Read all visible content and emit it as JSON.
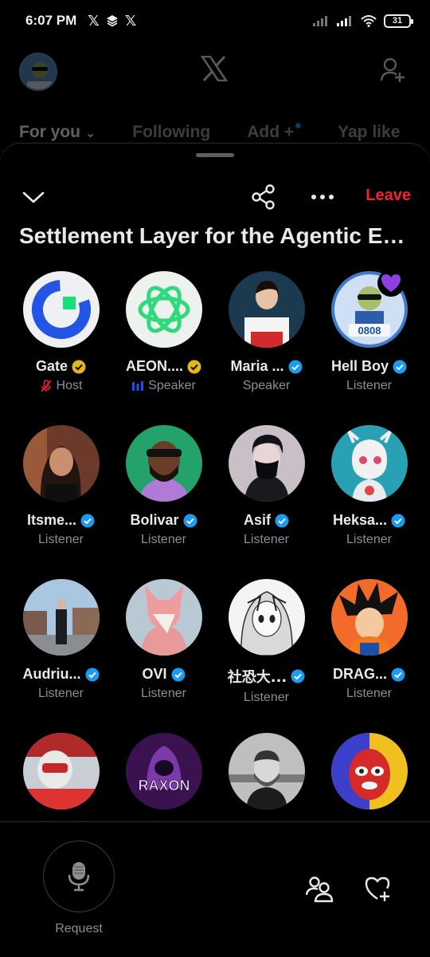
{
  "status_bar": {
    "time": "6:07 PM",
    "battery": "31"
  },
  "background_app": {
    "tabs": [
      {
        "label": "For you"
      },
      {
        "label": "Following"
      },
      {
        "label": "Add +"
      },
      {
        "label": "Yap like"
      }
    ]
  },
  "space": {
    "leave_label": "Leave",
    "title": "Settlement Layer for the Agentic Economy"
  },
  "participants": [
    {
      "name": "Gate",
      "role": "Host",
      "badge": "gold"
    },
    {
      "name": "AEON....",
      "role": "Speaker",
      "badge": "gold"
    },
    {
      "name": "Maria ...",
      "role": "Speaker",
      "badge": "blue"
    },
    {
      "name": "Hell Boy",
      "role": "Listener",
      "badge": "blue"
    },
    {
      "name": "Itsme...",
      "role": "Listener",
      "badge": "blue"
    },
    {
      "name": "Bolivar",
      "role": "Listener",
      "badge": "blue"
    },
    {
      "name": "Asif",
      "role": "Listener",
      "badge": "blue"
    },
    {
      "name": "Heksa...",
      "role": "Listener",
      "badge": "blue"
    },
    {
      "name": "Audriu...",
      "role": "Listener",
      "badge": "blue"
    },
    {
      "name": "OVI",
      "role": "Listener",
      "badge": "blue"
    },
    {
      "name": "社恐大...",
      "role": "Listener",
      "badge": "blue"
    },
    {
      "name": "DRAG...",
      "role": "Listener",
      "badge": "blue"
    },
    {
      "name": "",
      "role": "",
      "badge": ""
    },
    {
      "name": "",
      "role": "",
      "badge": ""
    },
    {
      "name": "",
      "role": "",
      "badge": ""
    },
    {
      "name": "",
      "role": "",
      "badge": ""
    }
  ],
  "avatar_texts": {
    "hellboy_tag": "0808",
    "raxon": "RAXON"
  },
  "bottom_bar": {
    "request_label": "Request"
  },
  "colors": {
    "leave": "#f4212e",
    "verified_blue": "#1d9bf0",
    "verified_gold": "#e2b719",
    "speaker_blue": "#1d4ff0"
  }
}
